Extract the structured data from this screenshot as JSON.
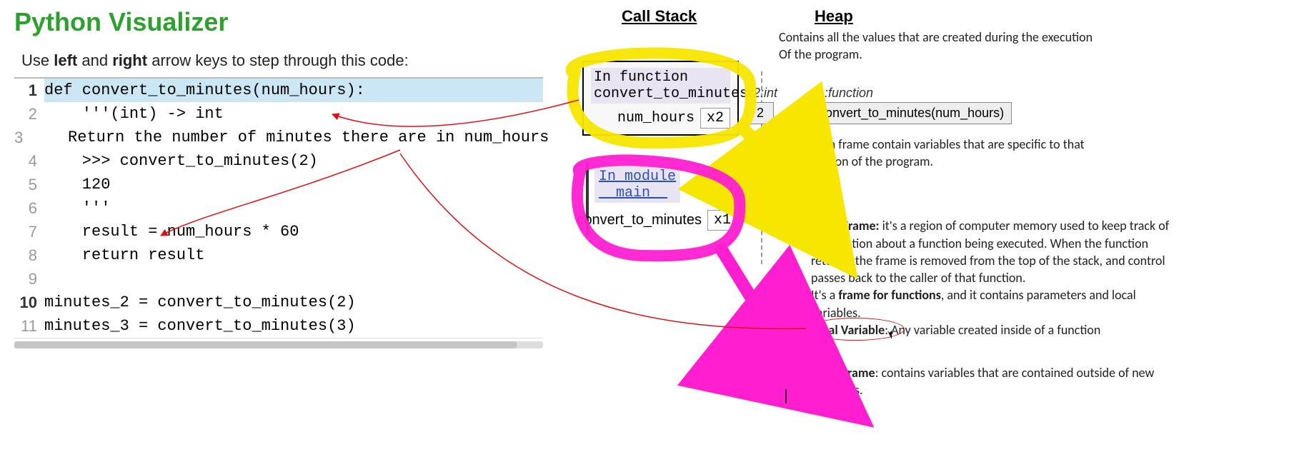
{
  "title": "Python Visualizer",
  "instructions_pre": "Use ",
  "instructions_b1": "left",
  "instructions_mid": " and ",
  "instructions_b2": "right",
  "instructions_post": " arrow keys to step through this code:",
  "code": {
    "l1": "def convert_to_minutes(num_hours):",
    "l2": "    '''(int) -> int",
    "l3": "    Return the number of minutes there are in num_hours",
    "l4": "    >>> convert_to_minutes(2)",
    "l5": "    120",
    "l6": "    '''",
    "l7": "    result = num_hours * 60",
    "l8": "    return result",
    "l9": "",
    "l10": "minutes_2 = convert_to_minutes(2)",
    "l11": "minutes_3 = convert_to_minutes(3)"
  },
  "headings": {
    "callstack": "Call Stack",
    "heap": "Heap"
  },
  "stack": {
    "top_frame_title_l1": "In function",
    "top_frame_title_l2": "convert_to_minutes",
    "top_var_name": "num_hours",
    "top_var_ref": "x2",
    "module_title_l1": "In module",
    "module_title_l2": "__main__",
    "module_var_name": "convert_to_minutes",
    "module_var_ref": "x1"
  },
  "heap": {
    "x2_label": "x2:int",
    "x2_value": "2",
    "x1_label": "x1:function",
    "x1_value": "convert_to_minutes(num_hours)",
    "desc_top": "Contains all the values that are created during the execution\nOf the program.",
    "each_frame": "Each frame contain variables that are specific to that section of the program.",
    "stack_frame_title": "Stack Frame:",
    "stack_frame_body": " it's a region of computer memory used to keep track of information about a function being executed. When the function returns, the frame is removed from the top of the stack, and control passes back to the caller of that function.\nIt's a ",
    "stack_frame_bold2": "frame for functions",
    "stack_frame_body2": ", and it contains parameters and local variables.",
    "local_var_title": "Local Variable",
    "local_var_body": ": Any variable created inside of a function",
    "main_frame_title": "Main Frame",
    "main_frame_body": ": contains variables that are contained outside of new functions."
  }
}
